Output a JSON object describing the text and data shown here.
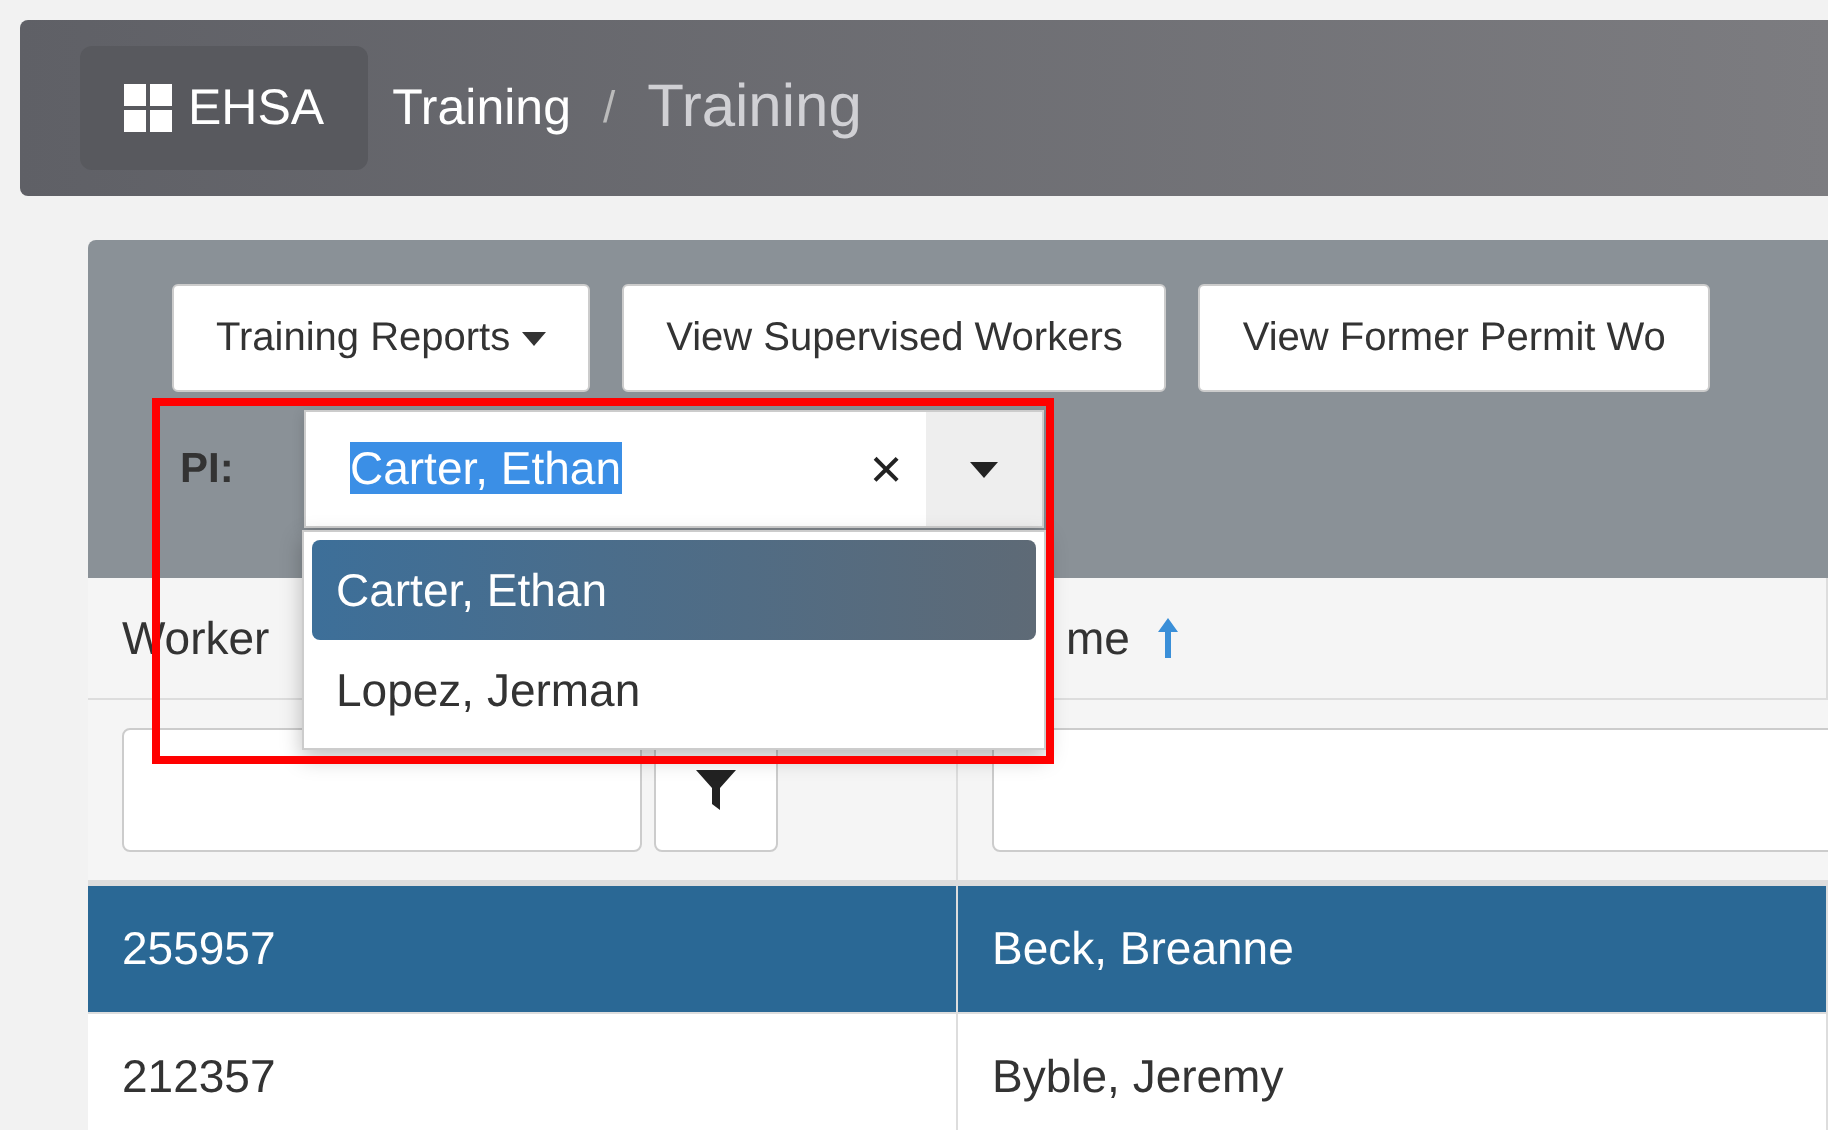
{
  "header": {
    "brand": "EHSA",
    "breadcrumb": [
      {
        "label": "Training",
        "current": false
      },
      {
        "label": "Training",
        "current": true
      }
    ],
    "separator": "/"
  },
  "toolbar": [
    {
      "label": "Training Reports",
      "kind": "dropdown"
    },
    {
      "label": "View Supervised Workers",
      "kind": "button"
    },
    {
      "label": "View Former Permit Wo",
      "kind": "button"
    }
  ],
  "pi_filter": {
    "label": "PI:",
    "value": "Carter, Ethan",
    "clear": "×",
    "expanded": true,
    "options": [
      {
        "label": "Carter, Ethan",
        "selected": true
      },
      {
        "label": "Lopez, Jerman",
        "selected": false
      }
    ]
  },
  "table": {
    "columns": [
      {
        "label": "Worker",
        "sorted": false
      },
      {
        "label": "me",
        "sorted": true
      }
    ],
    "rows": [
      {
        "cells": [
          "255957",
          "Beck, Breanne"
        ],
        "selected": true
      },
      {
        "cells": [
          "212357",
          "Byble, Jeremy"
        ],
        "selected": false
      }
    ]
  }
}
